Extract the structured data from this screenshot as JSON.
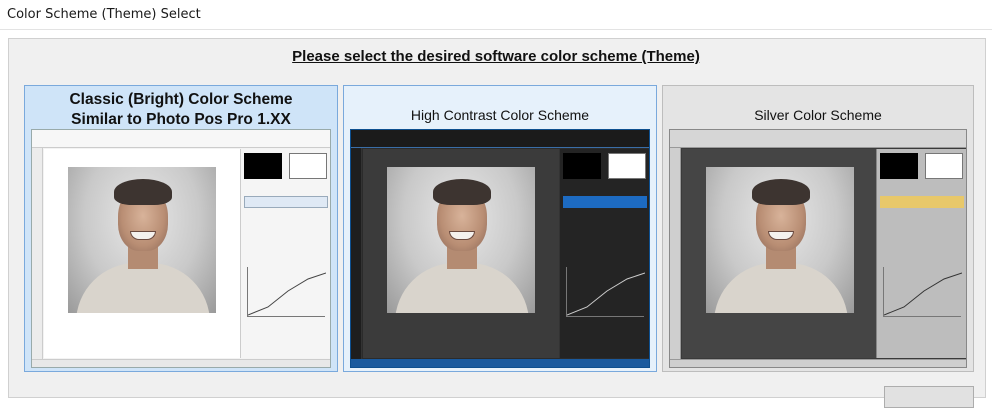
{
  "window": {
    "title": "Color Scheme (Theme) Select"
  },
  "heading": "Please select the desired software color scheme (Theme)",
  "schemes": [
    {
      "label_line1": "Classic (Bright) Color Scheme",
      "label_line2": "Similar to Photo Pos Pro 1.XX",
      "selected": true,
      "accent": "#7aa9dc"
    },
    {
      "label": "High Contrast Color Scheme",
      "accent": "#1d6bc2"
    },
    {
      "label": "Silver Color Scheme",
      "accent": "#e8c86a"
    }
  ]
}
